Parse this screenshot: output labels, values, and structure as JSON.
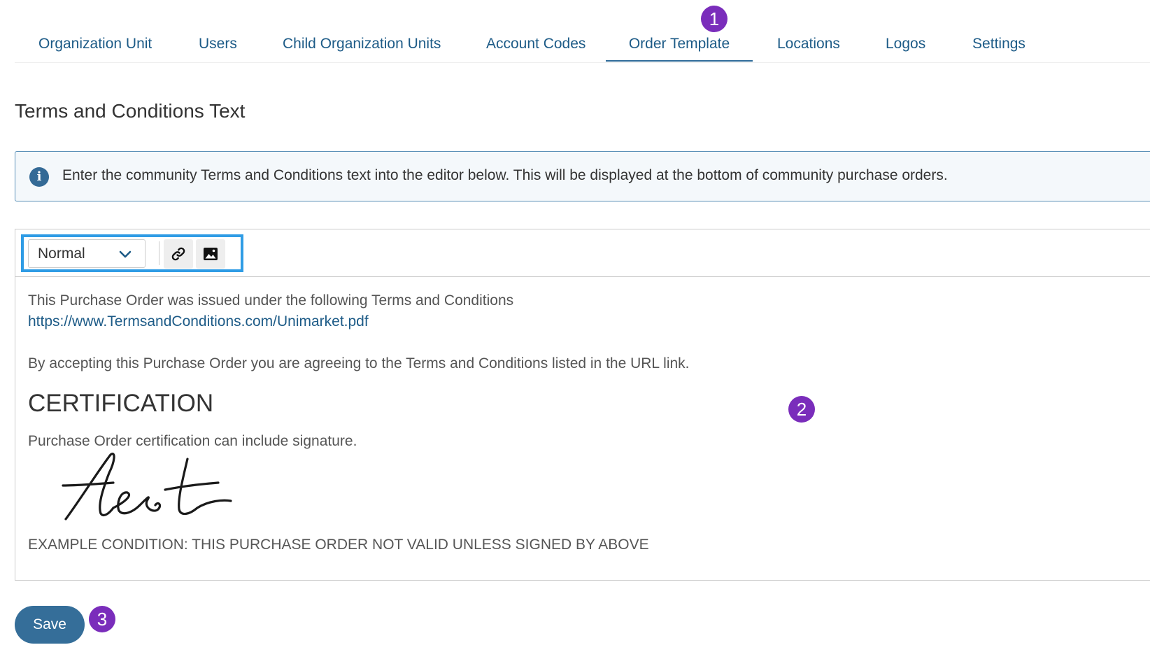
{
  "tabs": [
    {
      "label": "Organization Unit"
    },
    {
      "label": "Users"
    },
    {
      "label": "Child Organization Units"
    },
    {
      "label": "Account Codes"
    },
    {
      "label": "Order Template"
    },
    {
      "label": "Locations"
    },
    {
      "label": "Logos"
    },
    {
      "label": "Settings"
    }
  ],
  "active_tab": "Order Template",
  "badges": [
    "1",
    "2",
    "3"
  ],
  "section_title": "Terms and Conditions Text",
  "info": {
    "icon": "info-icon",
    "text": "Enter the community Terms and Conditions text into the editor below. This will be displayed at the bottom of community purchase orders."
  },
  "toolbar": {
    "format_value": "Normal",
    "link_icon": "link-icon",
    "image_icon": "image-icon"
  },
  "editor": {
    "line1": "This Purchase Order was issued under the following Terms and Conditions",
    "link": "https://www.TermsandConditions.com/Unimarket.pdf",
    "line2": "By accepting this Purchase Order you are agreeing to the Terms and Conditions listed in the URL link.",
    "heading": "CERTIFICATION",
    "line3": "Purchase Order certification can include signature.",
    "signature_text": "test",
    "line4": "EXAMPLE CONDITION: THIS PURCHASE ORDER NOT VALID UNLESS SIGNED BY ABOVE"
  },
  "save_label": "Save",
  "colors": {
    "accent": "#1d5b87",
    "badge": "#7a2dbb",
    "highlight": "#2f9ce5",
    "save_button": "#356e99"
  }
}
